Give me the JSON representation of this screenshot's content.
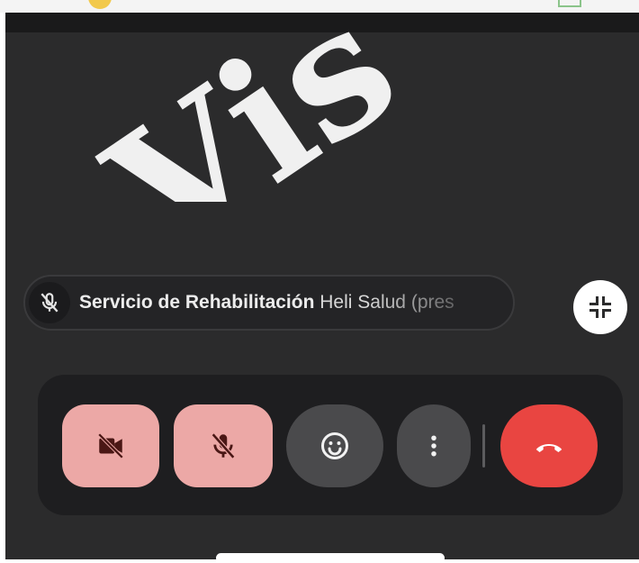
{
  "participant": {
    "name_visible": "Servicio de Rehabilitación",
    "name_faded": "Heli Salud (pres",
    "mic_muted": true
  },
  "controls": {
    "camera_off": true,
    "mic_off": true
  },
  "watermark_text": "Vis",
  "colors": {
    "muted_button": "#eca8a6",
    "hangup": "#e94541",
    "neutral_button": "#4a4a4c",
    "background": "#2b2b2c"
  },
  "icons": {
    "pill_mic": "mic-off-icon",
    "collapse": "collapse-icon",
    "camera": "camera-off-icon",
    "mic": "mic-off-icon",
    "emoji": "emoji-icon",
    "more": "more-vertical-icon",
    "hangup": "phone-hangup-icon"
  }
}
